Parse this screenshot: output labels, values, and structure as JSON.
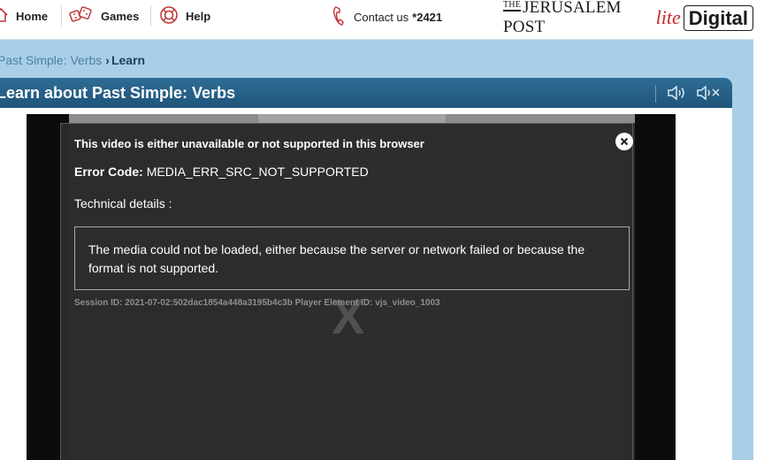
{
  "nav": {
    "items": [
      {
        "label": "Home",
        "icon": "home-icon"
      },
      {
        "label": "Games",
        "icon": "games-icon"
      },
      {
        "label": "Help",
        "icon": "lifebuoy-icon"
      }
    ],
    "contact_label": "Contact us",
    "contact_number": "*2421",
    "logo": {
      "the": "THE",
      "name": "JERUSALEM POST",
      "lite": "lite",
      "digital": "Digital"
    }
  },
  "breadcrumb": {
    "parent": "Past Simple: Verbs",
    "separator": "›",
    "current": "Learn"
  },
  "lesson": {
    "title": "Learn about Past Simple: Verbs",
    "audio_on_icon": "speaker-on-icon",
    "audio_off_icon": "speaker-mute-icon"
  },
  "video_error": {
    "heading": "This video is either unavailable or not supported in this browser",
    "code_label": "Error Code:",
    "code_value": "MEDIA_ERR_SRC_NOT_SUPPORTED",
    "tech_label": "Technical details :",
    "details": "The media could not be loaded, either because the server or network failed or because the format is not supported.",
    "session": "Session ID: 2021-07-02:502dac1854a448a3195b4c3b Player Element ID: vjs_video_1003",
    "x_mark": "X",
    "close_icon": "close-icon"
  },
  "colors": {
    "page_bg": "#a9cfe8",
    "header_bar": "#2a6690",
    "breadcrumb_link": "#4e7fa5",
    "breadcrumb_current": "#1d3f5e",
    "nav_icon": "#c0393b",
    "logo_lite": "#c62a2a"
  }
}
